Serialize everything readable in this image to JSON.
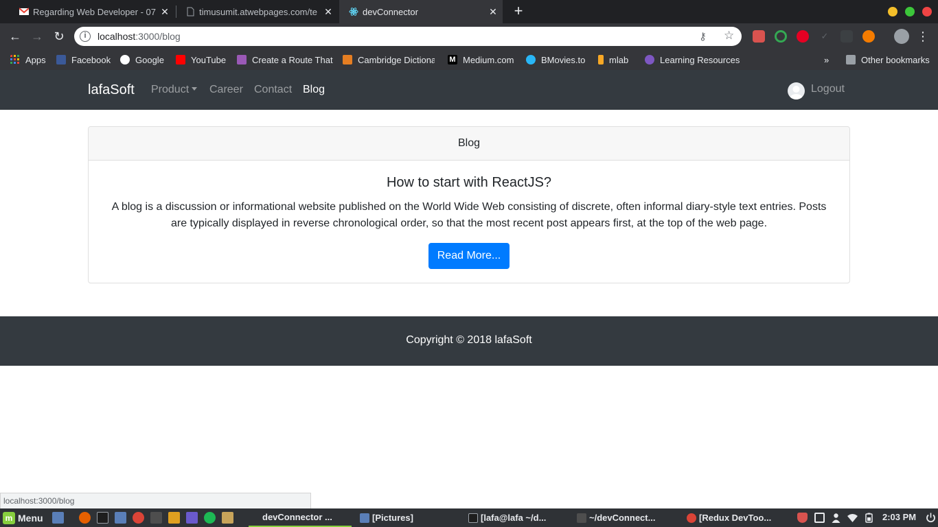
{
  "browser": {
    "tabs": [
      {
        "title": "Regarding Web Developer - 07 ",
        "favicon": "gmail-icon"
      },
      {
        "title": "timusumit.atwebpages.com/te",
        "favicon": "document-icon"
      },
      {
        "title": "devConnector",
        "favicon": "react-icon"
      }
    ],
    "address": {
      "host": "localhost",
      "path": ":3000/blog"
    },
    "bookmarks": [
      {
        "label": "Apps",
        "color": "#ea4335"
      },
      {
        "label": "Facebook",
        "color": "#3b5998"
      },
      {
        "label": "Google",
        "color": "#ffffff"
      },
      {
        "label": "YouTube",
        "color": "#ff0000"
      },
      {
        "label": "Create a Route That",
        "color": "#9b59b6"
      },
      {
        "label": "Cambridge Dictiona",
        "color": "#e67e22"
      },
      {
        "label": "Medium.com",
        "color": "#000000"
      },
      {
        "label": "BMovies.to",
        "color": "#29b6f6"
      },
      {
        "label": "mlab",
        "color": "#f9a825"
      },
      {
        "label": "Learning Resources",
        "color": "#7e57c2"
      }
    ],
    "other_bookmarks": "Other bookmarks",
    "more_bookmarks": "»"
  },
  "site": {
    "brand": "lafaSoft",
    "nav": {
      "product": "Product",
      "career": "Career",
      "contact": "Contact",
      "blog": "Blog"
    },
    "logout": "Logout",
    "card": {
      "header": "Blog",
      "title": "How to start with ReactJS?",
      "text": "A blog is a discussion or informational website published on the World Wide Web consisting of discrete, often informal diary-style text entries. Posts are typically displayed in reverse chronological order, so that the most recent post appears first, at the top of the web page.",
      "button": "Read More..."
    },
    "footer": "Copyright © 2018 lafaSoft"
  },
  "status_url": "localhost:3000/blog",
  "taskbar": {
    "menu": "Menu",
    "tasks": [
      "devConnector ...",
      "[Pictures]",
      "[lafa@lafa ~/d...",
      "~/devConnect...",
      "[Redux DevToo..."
    ],
    "clock": "2:03 PM"
  },
  "colors": {
    "navbar": "#343a40",
    "primary": "#007bff"
  }
}
